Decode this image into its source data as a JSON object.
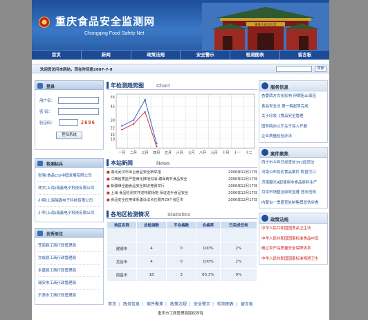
{
  "header": {
    "title": "重庆食品安全监测网",
    "subtitle": "Chongqing Food Safety Net",
    "gate_sign": "重庆人民大礼堂"
  },
  "nav": [
    "首页",
    "新闻",
    "政策法规",
    "安全警示",
    "检测图表",
    "留言板"
  ],
  "welcome": {
    "text": "欢迎您访问本网站，现在时间是2007-7-9",
    "search_button": "搜索"
  },
  "login": {
    "title": "登录",
    "username_label": "用户名：",
    "password_label": "密  码：",
    "captcha_label": "验证码：",
    "captcha_code": "2686",
    "submit": "登陆系统"
  },
  "standards": {
    "title": "检测标兵",
    "items": [
      "张强(食品CS)中国发展有限公司",
      "林文(上海)瑞鑫电子科技有限公司",
      "小明(上海瑞鑫电子科技有限公司",
      "小李(上海)瑞鑫电子科技有限公司"
    ]
  },
  "units": {
    "title": "优秀单位",
    "items": [
      "苍南县工商行政管理局",
      "文成县工商行政管理局",
      "永嘉县工商行政管理局",
      "瑞安市工商行政管理局",
      "乐清市工商行政管理局"
    ]
  },
  "chart_section": {
    "title_cn": "年检测趋势图",
    "title_en": "Chart"
  },
  "chart_data": {
    "type": "line",
    "categories": [
      "一月",
      "二月",
      "三月",
      "四月",
      "五月",
      "六月",
      "七月",
      "八月",
      "九月",
      "十月",
      "十一",
      "十二"
    ],
    "series": [
      {
        "values": [
          24,
          30,
          52,
          5,
          null,
          null,
          null,
          null,
          null,
          null,
          null,
          null
        ],
        "color": "#3a5fd0"
      },
      {
        "values": [
          20,
          26,
          39,
          2,
          null,
          null,
          null,
          null,
          null,
          null,
          null,
          null
        ],
        "color": "#c04040"
      }
    ],
    "yticks": [
      10,
      15,
      22,
      30,
      45,
      55
    ],
    "ylim": [
      0,
      58
    ],
    "grid": true
  },
  "news_section": {
    "title_cn": "本站新闻",
    "title_en": "News",
    "items": [
      {
        "title": "湖北武汉市出台食品安全新举措",
        "date": "2006年12月17日"
      },
      {
        "title": "江西省质监严查两化推地沟油 确保两节食品安全",
        "date": "2006年12月17日"
      },
      {
        "title": "新疆维全面食品安全知识竞赛举行",
        "date": "2006年12月17日"
      },
      {
        "title": "上海 食品检测实开进特勤场馆 保证选手食品安全",
        "date": "2006年12月17日"
      },
      {
        "title": "食品安全应用体系建设试点已展开29个省区市",
        "date": "2006年12月17日"
      }
    ]
  },
  "stats_section": {
    "title_cn": "各地区检测情况",
    "title_en": "Statistics",
    "headers": [
      "地区名称",
      "总检测数",
      "不合格数",
      "合格率",
      "已完成任务"
    ],
    "rows": [
      [
        "",
        "",
        "",
        "",
        ""
      ],
      [
        "建德市",
        "4",
        "0",
        "100%",
        "2%"
      ],
      [
        "龙谷市",
        "4",
        "0",
        "100%",
        "2%"
      ],
      [
        "南昌市",
        "18",
        "3",
        "83.3%",
        "9%"
      ]
    ]
  },
  "right_news": {
    "title": "服务信息",
    "items": [
      "杏委西方文化影响 伊朗阻止泗冠",
      "食品安全法 第一稿起草完成",
      "关于印发《食品安全管理",
      "国务院办公厅关于深入开展",
      "企业质量检验办法"
    ]
  },
  "right_cases": {
    "title": "案件聚焦",
    "items": [
      "西宁市今年已经查处392起违法",
      "河南公布伪劣食品案件 假冒可口",
      "济南曝光4起使用非食品原料生产",
      "月饼市场整治收效显著 违法违规",
      "内蒙古一季度查处制售假冒伪劣食"
    ]
  },
  "right_laws": {
    "title": "政策法规",
    "items": [
      "中华人民共和国国食品卫生法",
      "中华人民共和国国家标准食品中亚",
      "确立农产品质量安全保障体系",
      "中华人民共和国国家标准啤酒卫生"
    ]
  },
  "footer": {
    "links": [
      "首页",
      "政务信息",
      "案件聚焦",
      "政策法规",
      "安全警示",
      "检测图表",
      "留言板"
    ],
    "copyright": "重庆市工商管理局版权所有"
  }
}
